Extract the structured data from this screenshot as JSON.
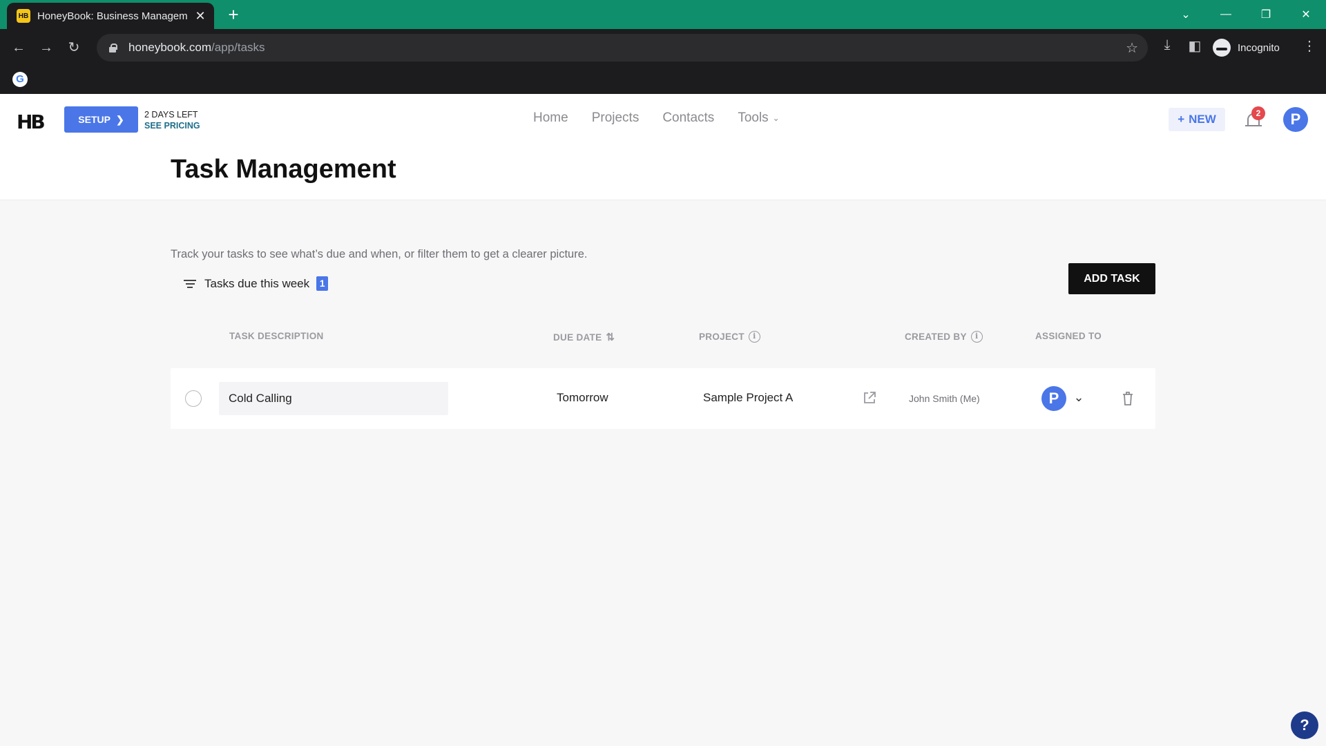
{
  "browser": {
    "tab_title": "HoneyBook: Business Managem",
    "tab_favicon": "HB",
    "url_host": "honeybook.com",
    "url_path": "/app/tasks",
    "profile_label": "Incognito"
  },
  "header": {
    "setup_label": "SETUP",
    "trial_days": "2 DAYS LEFT",
    "trial_pricing": "SEE PRICING",
    "nav": {
      "home": "Home",
      "projects": "Projects",
      "contacts": "Contacts",
      "tools": "Tools"
    },
    "new_label": "NEW",
    "notification_count": "2",
    "avatar_initial": "P"
  },
  "page": {
    "title": "Task Management",
    "intro": "Track your tasks to see what’s due and when, or filter them to get a clearer picture.",
    "filter_label": "Tasks due this week",
    "filter_count": "1",
    "add_task_label": "ADD TASK"
  },
  "table": {
    "headers": {
      "description": "TASK DESCRIPTION",
      "due_date": "DUE DATE",
      "project": "PROJECT",
      "created_by": "CREATED BY",
      "assigned_to": "ASSIGNED TO"
    },
    "rows": [
      {
        "description": "Cold Calling",
        "due": "Tomorrow",
        "project": "Sample Project A",
        "created_by": "John Smith (Me)",
        "assignee_initial": "P"
      }
    ]
  },
  "help_label": "?",
  "colors": {
    "accent": "#4a76e8",
    "chrome": "#0f8f6b",
    "dark": "#111111"
  }
}
